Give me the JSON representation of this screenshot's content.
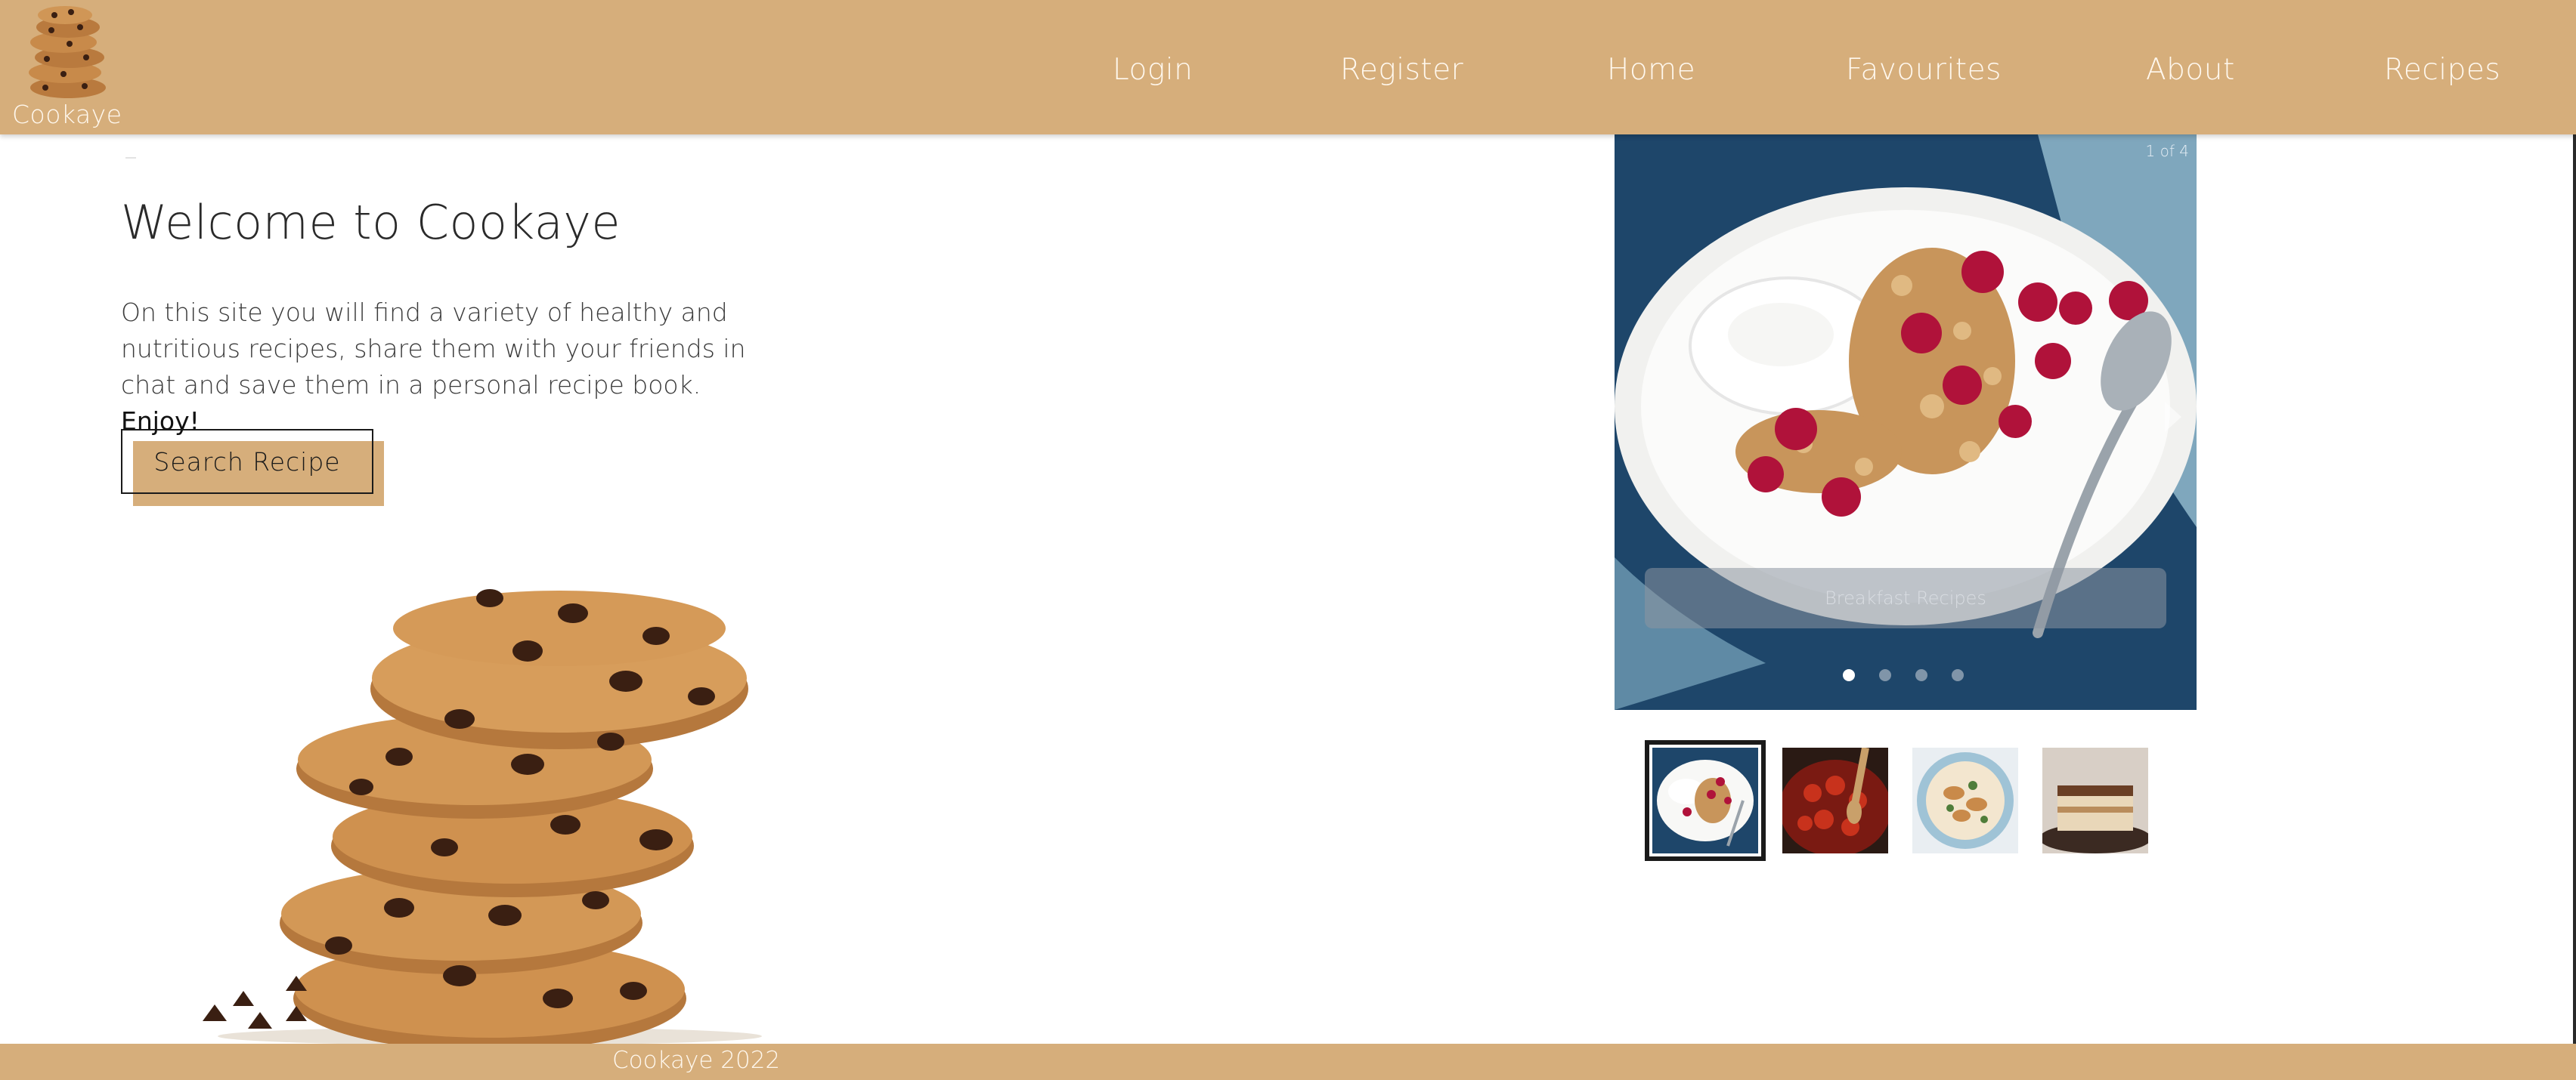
{
  "header": {
    "brand_name": "Cookaye",
    "nav": {
      "login": "Login",
      "register": "Register",
      "home": "Home",
      "favourites": "Favourites",
      "about": "About",
      "recipes": "Recipes"
    }
  },
  "hero": {
    "title": "Welcome to Cookaye",
    "description": "On this site you will find a variety of healthy and nutritious recipes, share them with your friends in chat and save them in a personal recipe book.",
    "description_emphasis": "Enjoy!",
    "search_button": "Search Recipe"
  },
  "carousel": {
    "counter": "1 of 4",
    "caption": "Breakfast Recipes",
    "active_index": 0,
    "slide_count": 4
  },
  "footer": {
    "text": "Cookaye 2022"
  },
  "colors": {
    "brand": "#d6ae7b",
    "nav_text": "#fff8ee",
    "heading": "#2a2a2a"
  }
}
